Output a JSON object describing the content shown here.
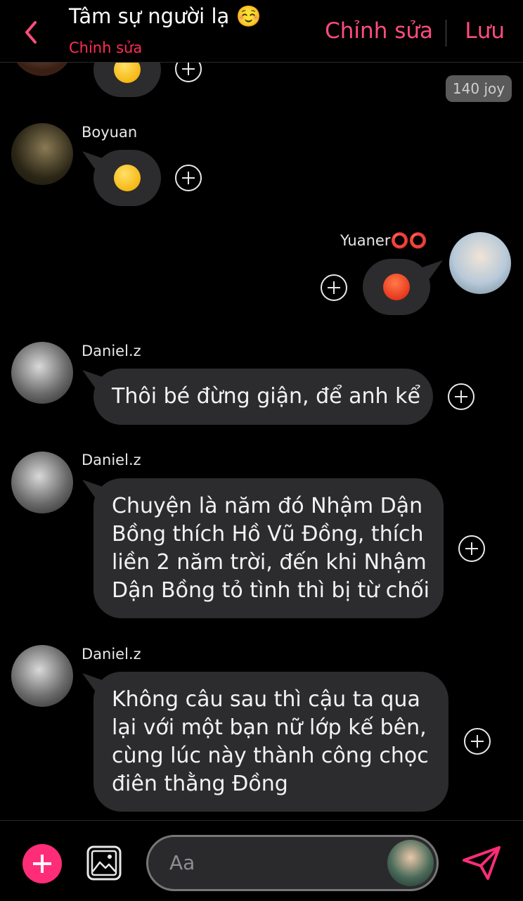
{
  "header": {
    "title": "Tâm sự người lạ ☺️",
    "subtitle": "Chỉnh sửa",
    "edit_label": "Chỉnh sửa",
    "save_label": "Lưu"
  },
  "badge": {
    "label": "140 joy"
  },
  "messages": [
    {
      "sender": "",
      "text": "😏",
      "type": "emoji"
    },
    {
      "sender": "Boyuan",
      "text": "😏",
      "type": "emoji"
    },
    {
      "sender": "Yuaner⭕⭕",
      "text": "😡",
      "type": "emoji",
      "outgoing": true
    },
    {
      "sender": "Daniel.z",
      "text": "Thôi bé đừng giận, để anh kể"
    },
    {
      "sender": "Daniel.z",
      "lines": [
        "Chuyện là năm đó Nhậm Dận",
        "Bồng thích Hồ Vũ Đồng, thích",
        "liền 2 năm trời, đến khi Nhậm",
        "Dận Bồng tỏ tình thì bị từ chối"
      ]
    },
    {
      "sender": "Daniel.z",
      "lines": [
        "Không câu sau thì cậu ta qua",
        "lại với một bạn nữ lớp kế bên,",
        "cùng lúc này thành công chọc",
        "điên thằng Đồng"
      ]
    }
  ],
  "composer": {
    "placeholder": "Aa"
  },
  "colors": {
    "accent": "#ff4d7d",
    "bubble": "#2c2c2e",
    "background": "#000000"
  },
  "icons": [
    "back-chevron-icon",
    "plus-circle-icon",
    "gallery-icon",
    "send-icon",
    "add-icon"
  ]
}
